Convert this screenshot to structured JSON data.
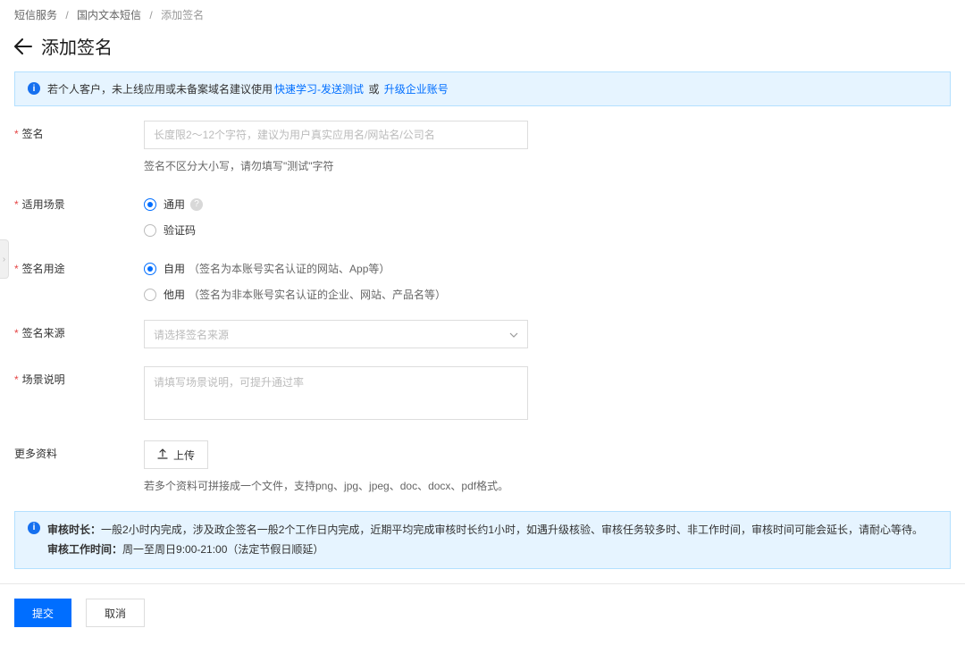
{
  "breadcrumb": {
    "item1": "短信服务",
    "item2": "国内文本短信",
    "item3": "添加签名"
  },
  "page_title": "添加签名",
  "alert1": {
    "prefix": "若个人客户，未上线应用或未备案域名建议使用",
    "link1": "快速学习-发送测试",
    "mid": " 或 ",
    "link2": "升级企业账号"
  },
  "form": {
    "signature": {
      "label": "签名",
      "placeholder": "长度限2～12个字符，建议为用户真实应用名/网站名/公司名",
      "help": "签名不区分大小写，请勿填写\"测试\"字符"
    },
    "scenario": {
      "label": "适用场景",
      "opt1": "通用",
      "opt2": "验证码"
    },
    "usage": {
      "label": "签名用途",
      "opt1": "自用",
      "opt1_desc": "（签名为本账号实名认证的网站、App等）",
      "opt2": "他用",
      "opt2_desc": "（签名为非本账号实名认证的企业、网站、产品名等）"
    },
    "source": {
      "label": "签名来源",
      "placeholder": "请选择签名来源"
    },
    "scene_desc": {
      "label": "场景说明",
      "placeholder": "请填写场景说明，可提升通过率"
    },
    "more": {
      "label": "更多资料",
      "upload_btn": "上传",
      "help": "若多个资料可拼接成一个文件，支持png、jpg、jpeg、doc、docx、pdf格式。"
    }
  },
  "alert2": {
    "label1": "审核时长：",
    "text1": "一般2小时内完成，涉及政企签名一般2个工作日内完成，近期平均完成审核时长约1小时，如遇升级核验、审核任务较多时、非工作时间，审核时间可能会延长，请耐心等待。",
    "label2": "审核工作时间：",
    "text2": "周一至周日9:00-21:00（法定节假日顺延）"
  },
  "footer": {
    "submit": "提交",
    "cancel": "取消"
  }
}
